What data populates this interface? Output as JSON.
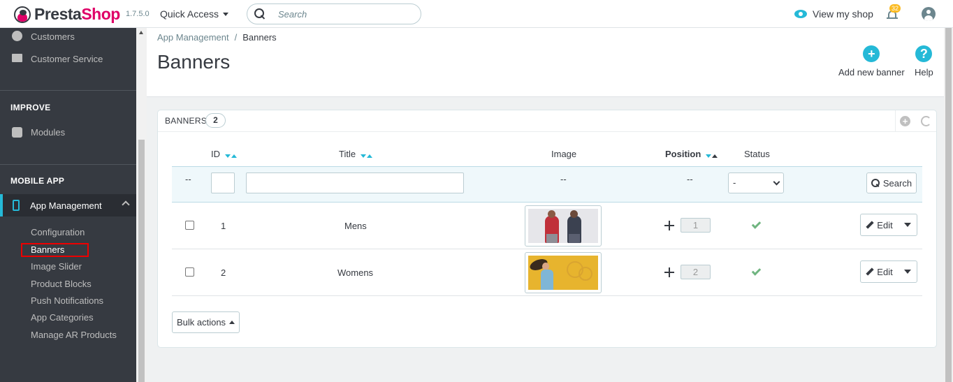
{
  "header": {
    "logo_part1": "Presta",
    "logo_part2": "Shop",
    "version": "1.7.5.0",
    "quick_access": "Quick Access",
    "search_placeholder": "Search",
    "view_shop": "View my shop",
    "notifications_count": "32"
  },
  "sidebar": {
    "items_top": [
      {
        "label": "Customers",
        "icon": "user-icon"
      },
      {
        "label": "Customer Service",
        "icon": "chat-icon"
      }
    ],
    "section_improve": "IMPROVE",
    "modules": {
      "label": "Modules",
      "icon": "puzzle-icon"
    },
    "section_mobile": "MOBILE APP",
    "active_item": {
      "label": "App Management",
      "icon": "phone-icon"
    },
    "sub_items": [
      "Configuration",
      "Banners",
      "Image Slider",
      "Product Blocks",
      "Push Notifications",
      "App Categories",
      "Manage AR Products"
    ]
  },
  "page": {
    "breadcrumb_parent": "App Management",
    "breadcrumb_sep": "/",
    "breadcrumb_current": "Banners",
    "title": "Banners",
    "add_new_label": "Add new banner",
    "help_label": "Help"
  },
  "panel": {
    "title": "BANNERS",
    "count": "2",
    "columns": {
      "id": "ID",
      "title": "Title",
      "image": "Image",
      "position": "Position",
      "status": "Status"
    },
    "filter": {
      "dash": "--",
      "status_selected": "-",
      "search_label": "Search"
    },
    "rows": [
      {
        "id": "1",
        "title": "Mens",
        "position": "1",
        "status": "enabled"
      },
      {
        "id": "2",
        "title": "Womens",
        "position": "2",
        "status": "enabled"
      }
    ],
    "edit_label": "Edit",
    "bulk_label": "Bulk actions"
  },
  "colors": {
    "accent": "#25b9d7",
    "brand_pink": "#df0067",
    "sidebar_bg": "#363a41",
    "success": "#70b580",
    "highlight_box": "#ee0000"
  }
}
